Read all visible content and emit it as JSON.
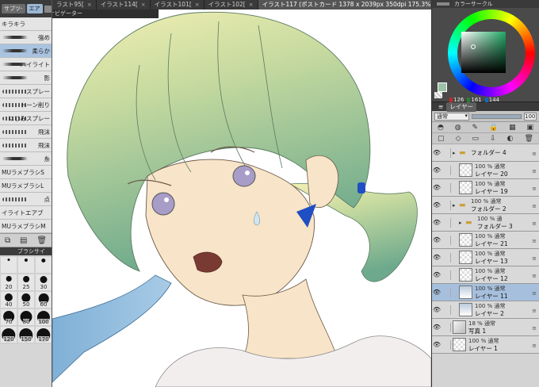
{
  "left_panel": {
    "tabs": [
      "サブツ-",
      "エア"
    ],
    "brushes": [
      {
        "label": "キラキラ",
        "kind": "text",
        "selected": false
      },
      {
        "label": "強め",
        "kind": "stroke",
        "selected": false
      },
      {
        "label": "柔らか",
        "kind": "stroke",
        "selected": true
      },
      {
        "label": "ハイライト",
        "kind": "stroke",
        "selected": false
      },
      {
        "label": "影",
        "kind": "stroke",
        "selected": false
      },
      {
        "label": "スプレー",
        "kind": "dots",
        "selected": false
      },
      {
        "label": "トーン削り",
        "kind": "dots",
        "selected": false
      },
      {
        "label": "にじみスプレー",
        "kind": "dots",
        "selected": false
      },
      {
        "label": "飛沫",
        "kind": "dots",
        "selected": false
      },
      {
        "label": "飛沫",
        "kind": "dots",
        "selected": false
      },
      {
        "label": "糸",
        "kind": "stroke",
        "selected": false
      },
      {
        "label": "MUラメブラシS",
        "kind": "text",
        "selected": false
      },
      {
        "label": "MUラメブラシL",
        "kind": "text",
        "selected": false
      },
      {
        "label": "点",
        "kind": "dots",
        "selected": false
      },
      {
        "label": "イライトエアブ",
        "kind": "text",
        "selected": false
      },
      {
        "label": "MUラメブラシM",
        "kind": "text",
        "selected": false
      }
    ],
    "size_panel_title": "ブラシサイ",
    "brush_sizes": [
      "",
      "",
      "",
      "20",
      "25",
      "30",
      "40",
      "50",
      "60",
      "70",
      "80",
      "100",
      "120",
      "150",
      "170"
    ]
  },
  "tabs": [
    {
      "label": "ラスト95[",
      "active": false
    },
    {
      "label": "イラスト114[",
      "active": false
    },
    {
      "label": "イラスト101[",
      "active": false
    },
    {
      "label": "イラスト102[",
      "active": false
    },
    {
      "label": "イラスト117 (ポストカード 1378 x 2039px 350dpi 175.3%)",
      "active": true
    }
  ],
  "navigator_label": "ナビゲーター",
  "color_panel": {
    "title": "カラーサークル",
    "rgb": [
      "126",
      "161",
      "144"
    ],
    "colors": {
      "r": "#c62828",
      "g": "#2e7d32",
      "b": "#1565c0",
      "current": "#9cc2a8"
    }
  },
  "layer_panel": {
    "title": "レイヤー",
    "blend_mode": "通常",
    "opacity": "100",
    "layers": [
      {
        "type": "folder",
        "line1": "",
        "line2": "フォルダー 4",
        "indent": 0,
        "selected": false,
        "eye": true,
        "thumb": "folder"
      },
      {
        "type": "layer",
        "line1": "100 % 通常",
        "line2": "レイヤー 20",
        "indent": 1,
        "selected": false,
        "eye": true,
        "thumb": "blank"
      },
      {
        "type": "layer",
        "line1": "100 % 通常",
        "line2": "レイヤー 19",
        "indent": 1,
        "selected": false,
        "eye": true,
        "thumb": "blank"
      },
      {
        "type": "folder",
        "line1": "100 % 通常",
        "line2": "フォルダー 2",
        "indent": 0,
        "selected": false,
        "eye": true,
        "thumb": "folder"
      },
      {
        "type": "folder",
        "line1": "100 % 通",
        "line2": "フォルダー 3",
        "indent": 1,
        "selected": false,
        "eye": true,
        "thumb": "folder"
      },
      {
        "type": "layer",
        "line1": "100 % 通常",
        "line2": "レイヤー 21",
        "indent": 1,
        "selected": false,
        "eye": true,
        "thumb": "blank"
      },
      {
        "type": "layer",
        "line1": "100 % 通常",
        "line2": "レイヤー 13",
        "indent": 1,
        "selected": false,
        "eye": true,
        "thumb": "blank"
      },
      {
        "type": "layer",
        "line1": "100 % 通常",
        "line2": "レイヤー 12",
        "indent": 1,
        "selected": false,
        "eye": true,
        "thumb": "blank"
      },
      {
        "type": "layer",
        "line1": "100 % 通常",
        "line2": "レイヤー 11",
        "indent": 1,
        "selected": true,
        "eye": true,
        "thumb": "img"
      },
      {
        "type": "layer",
        "line1": "100 % 通常",
        "line2": "レイヤー 2",
        "indent": 1,
        "selected": false,
        "eye": true,
        "thumb": "img"
      },
      {
        "type": "layer",
        "line1": "18 % 通常",
        "line2": "写真 1",
        "indent": 0,
        "selected": false,
        "eye": true,
        "thumb": "photo"
      },
      {
        "type": "layer",
        "line1": "100 % 通常",
        "line2": "レイヤー 1",
        "indent": 0,
        "selected": false,
        "eye": true,
        "thumb": "blank"
      }
    ]
  }
}
